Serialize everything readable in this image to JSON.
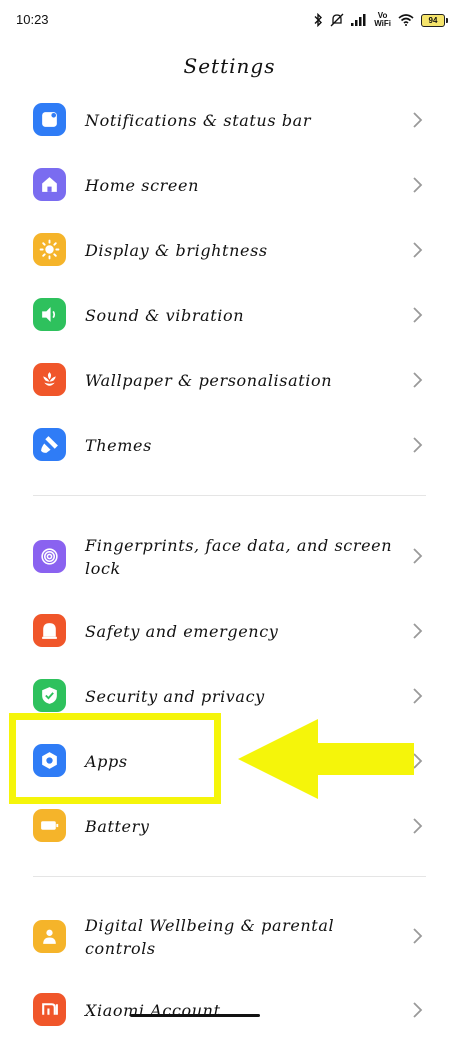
{
  "status_bar": {
    "time": "10:23",
    "volte_top": "Vo",
    "volte_bottom": "WiFi",
    "battery": "94"
  },
  "title": "Settings",
  "group1": [
    {
      "label": "Notifications & status bar",
      "icon": "notification-icon",
      "color": "#2f7cf6"
    },
    {
      "label": "Home screen",
      "icon": "home-icon",
      "color": "#7a6cf0"
    },
    {
      "label": "Display & brightness",
      "icon": "sun-icon",
      "color": "#f5b42a"
    },
    {
      "label": "Sound & vibration",
      "icon": "speaker-icon",
      "color": "#2ec15d"
    },
    {
      "label": "Wallpaper & personalisation",
      "icon": "flower-icon",
      "color": "#f0562a"
    },
    {
      "label": "Themes",
      "icon": "brush-icon",
      "color": "#2f7cf6"
    }
  ],
  "group2": [
    {
      "label": "Fingerprints, face data, and screen lock",
      "icon": "fingerprint-icon",
      "color": "#8a62f0"
    },
    {
      "label": "Safety and emergency",
      "icon": "alert-icon",
      "color": "#f0562a"
    },
    {
      "label": "Security and privacy",
      "icon": "shield-check-icon",
      "color": "#2ec15d"
    },
    {
      "label": "Apps",
      "icon": "apps-gear-icon",
      "color": "#2f7cf6"
    },
    {
      "label": "Battery",
      "icon": "battery-icon",
      "color": "#f5b42a"
    }
  ],
  "group3": [
    {
      "label": "Digital Wellbeing & parental controls",
      "icon": "wellbeing-icon",
      "color": "#f5b42a"
    },
    {
      "label": "Xiaomi Account",
      "icon": "mi-icon",
      "color": "#f0562a"
    }
  ],
  "annotation": {
    "highlight_color": "#f5f50a"
  }
}
